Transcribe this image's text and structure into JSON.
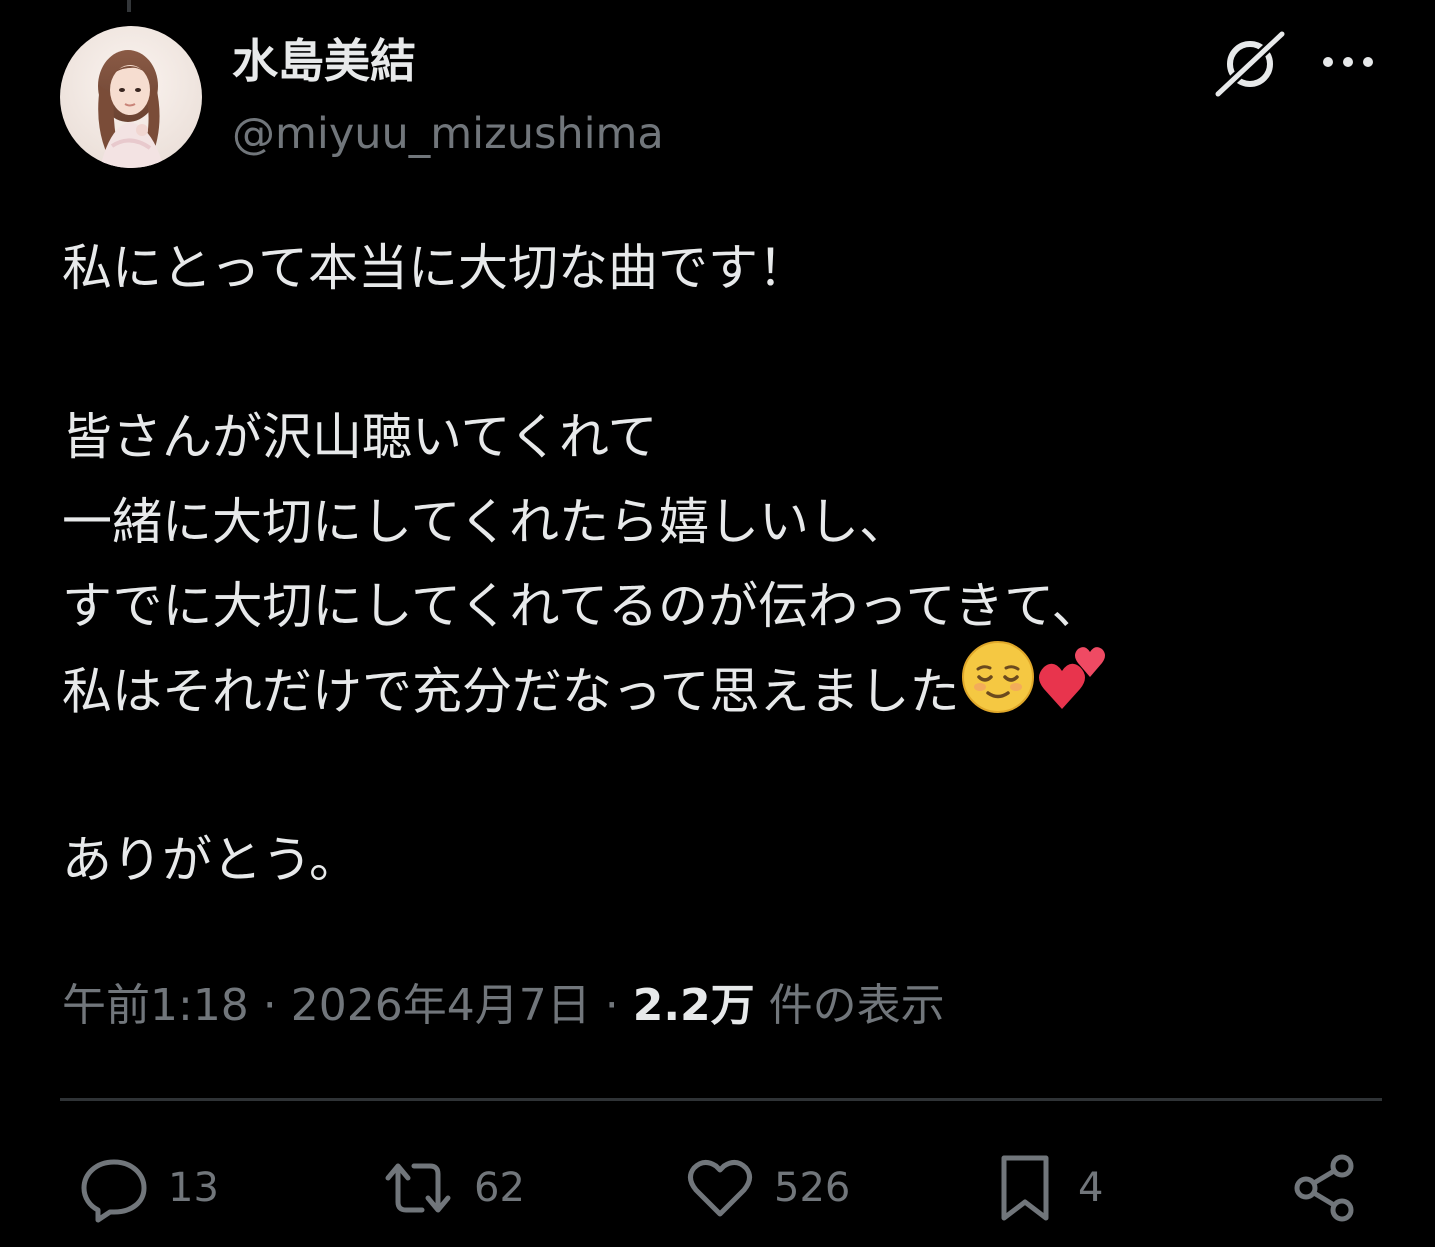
{
  "author": {
    "display_name": "水島美結",
    "handle": "@miyuu_mizushima"
  },
  "header_icons": {
    "grok": "grok-icon",
    "more": "more-icon"
  },
  "tweet": {
    "lines": [
      "私にとって本当に大切な曲です！",
      "",
      "皆さんが沢山聴いてくれて",
      "一緒に大切にしてくれたら嬉しいし、",
      "すでに大切にしてくれてるのが伝わってきて、",
      "私はそれだけで充分だなって思えました",
      "",
      "ありがとう。"
    ],
    "emojis": [
      "relieved-face-emoji",
      "two-hearts-emoji"
    ]
  },
  "meta": {
    "time": "午前1:18",
    "separator": " · ",
    "date": "2026年4月7日",
    "views_count": "2.2万",
    "views_label": " 件の表示"
  },
  "actions": {
    "replies": "13",
    "reposts": "62",
    "likes": "526",
    "bookmarks": "4"
  },
  "colors": {
    "background": "#000000",
    "text": "#e7e9ea",
    "secondary": "#71767b",
    "divider": "#2f3336"
  }
}
